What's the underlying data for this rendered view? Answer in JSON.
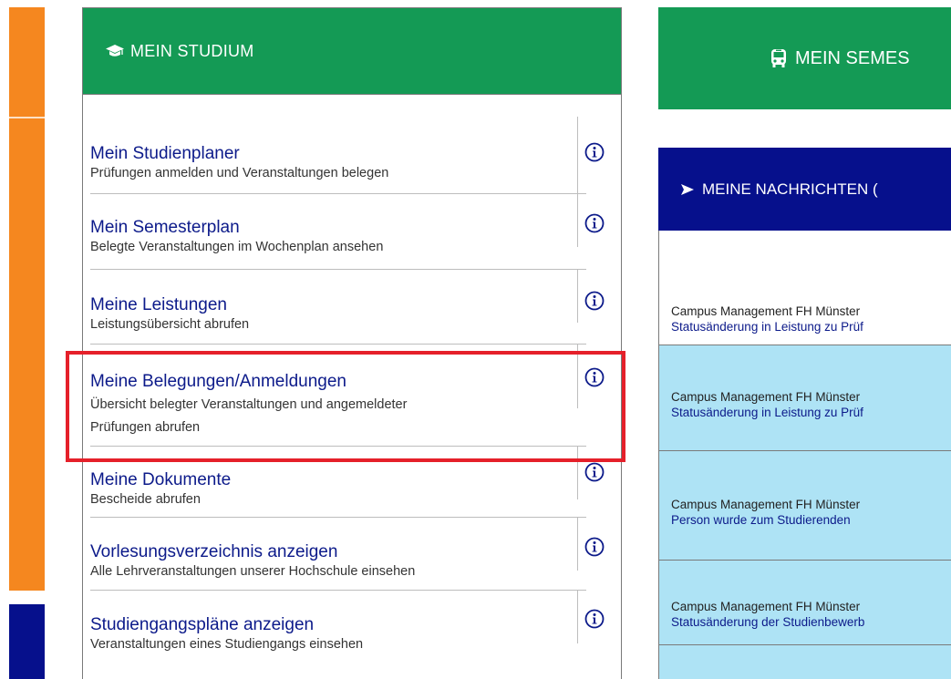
{
  "study": {
    "header": "MEIN STUDIUM",
    "items": [
      {
        "title": "Mein Studienplaner",
        "desc": "Prüfungen anmelden und Veranstaltungen belegen"
      },
      {
        "title": "Mein Semesterplan",
        "desc": "Belegte Veranstaltungen im Wochenplan ansehen"
      },
      {
        "title": "Meine Leistungen",
        "desc": "Leistungsübersicht abrufen"
      },
      {
        "title": "Meine Belegungen/Anmeldungen",
        "desc1": "Übersicht belegter Veranstaltungen und angemeldeter",
        "desc2": "Prüfungen abrufen"
      },
      {
        "title": "Meine Dokumente",
        "desc": "Bescheide abrufen"
      },
      {
        "title": "Vorlesungsverzeichnis anzeigen",
        "desc": "Alle Lehrveranstaltungen unserer Hochschule einsehen"
      },
      {
        "title": "Studiengangspläne anzeigen",
        "desc": "Veranstaltungen eines Studiengangs einsehen"
      }
    ]
  },
  "semester": {
    "header": "MEIN SEMES"
  },
  "messages": {
    "header": "MEINE NACHRICHTEN (",
    "items": [
      {
        "sender": "Campus Management FH Münster",
        "subject": "Statusänderung in Leistung zu Prüf"
      },
      {
        "sender": "Campus Management FH Münster",
        "subject": "Statusänderung in Leistung zu Prüf"
      },
      {
        "sender": "Campus Management FH Münster",
        "subject": "Person wurde zum Studierenden"
      },
      {
        "sender": "Campus Management FH Münster",
        "subject": "Statusänderung der Studienbewerb"
      }
    ]
  },
  "colors": {
    "green": "#149a55",
    "navy": "#06108c",
    "orange": "#f5871f",
    "light_blue": "#aee3f5",
    "highlight_red": "#e5202a"
  },
  "icons": {
    "study": "graduation-cap-icon",
    "semester": "bus-icon",
    "messages": "paper-plane-icon",
    "info": "info-circle-icon"
  }
}
